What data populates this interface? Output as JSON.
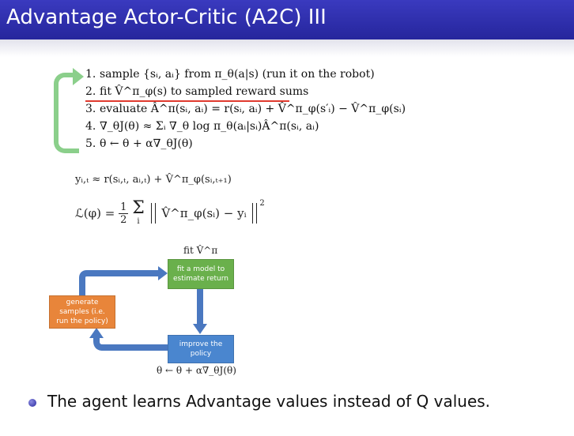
{
  "slide": {
    "title": "Advantage Actor-Critic (A2C) III"
  },
  "algorithm": {
    "steps": [
      {
        "num": "1.",
        "text": "sample {sᵢ, aᵢ} from π_θ(a|s) (run it on the robot)"
      },
      {
        "num": "2.",
        "text": "fit V̂^π_φ(s) to sampled reward sums"
      },
      {
        "num": "3.",
        "text": "evaluate Â^π(sᵢ, aᵢ) = r(sᵢ, aᵢ) + V̂^π_φ(s′ᵢ) − V̂^π_φ(sᵢ)"
      },
      {
        "num": "4.",
        "text": "∇_θJ(θ) ≈ Σᵢ ∇_θ log π_θ(aᵢ|sᵢ)Â^π(sᵢ, aᵢ)"
      },
      {
        "num": "5.",
        "text": "θ ← θ + α∇_θJ(θ)"
      }
    ]
  },
  "equations": {
    "target": "yᵢ,ₜ ≈ r(sᵢ,ₜ, aᵢ,ₜ) + V̂^π_φ(sᵢ,ₜ₊₁)",
    "loss_lhs": "ℒ(φ) =",
    "loss_frac_num": "1",
    "loss_frac_den": "2",
    "loss_sum": "Σ",
    "loss_sum_sub": "i",
    "loss_body": "V̂^π_φ(sᵢ) − yᵢ",
    "loss_power": "2"
  },
  "diagram": {
    "fit_label": "fit V̂^π",
    "box_fit": "fit a model to estimate return",
    "box_generate": "generate samples (i.e. run the policy)",
    "box_improve": "improve the policy",
    "update_label": "θ ← θ + α∇_θJ(θ)"
  },
  "bullets": [
    "The agent learns Advantage values instead of Q values."
  ],
  "colors": {
    "title_bar": "#2b2ba8",
    "bracket_green": "#8bcf8b",
    "underline_red": "#e03a2e",
    "box_green": "#6ab04c",
    "box_orange": "#e8853a",
    "box_blue": "#4a86cf",
    "arrow_blue": "#4a78c0"
  }
}
